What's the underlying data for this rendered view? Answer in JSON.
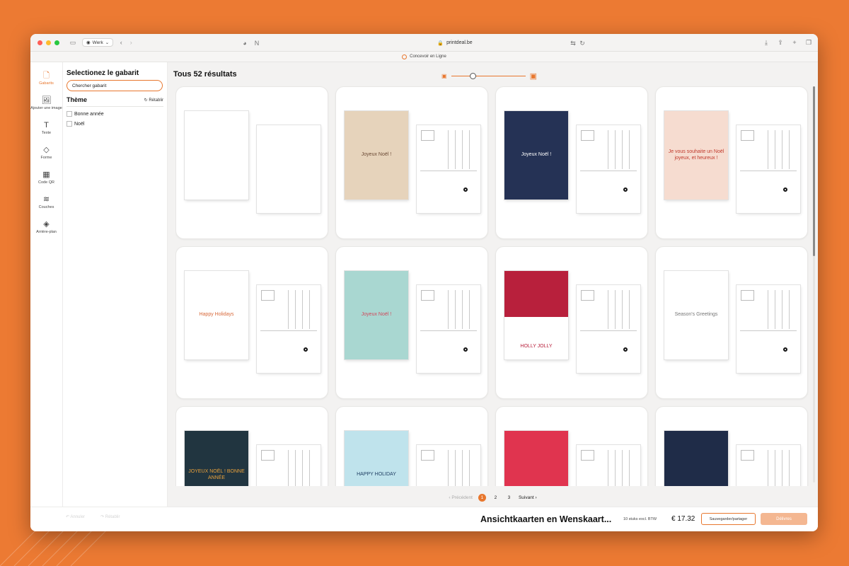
{
  "browser": {
    "profile_label": "Werk",
    "url": "printdeal.be",
    "page_title": "Concevoir en Ligne",
    "traffic_light_colors": [
      "#ff5f57",
      "#febc2e",
      "#28c840"
    ]
  },
  "rail": {
    "items": [
      {
        "label": "Gabarits",
        "icon": "template-icon"
      },
      {
        "label": "Ajouter une image",
        "icon": "image-icon"
      },
      {
        "label": "Texte",
        "icon": "text-icon"
      },
      {
        "label": "Forme",
        "icon": "shape-icon"
      },
      {
        "label": "Code QR",
        "icon": "qr-code-icon"
      },
      {
        "label": "Couches",
        "icon": "layers-icon"
      },
      {
        "label": "Arrière-plan",
        "icon": "paint-bucket-icon"
      }
    ]
  },
  "panel": {
    "title": "Selectionez le gabarit",
    "search_placeholder": "Chercher gabarit",
    "theme_title": "Thème",
    "reset_label": "Rétablir",
    "filters": [
      "Bonne année",
      "Noël"
    ]
  },
  "main": {
    "results_title": "Tous 52 résultats",
    "zoom_level": 0.25,
    "cards": [
      {
        "front_bg": "#ffffff",
        "front_text": "",
        "front_color": "#333333"
      },
      {
        "front_bg": "#e6d3bb",
        "front_text": "Joyeux Noël !",
        "front_color": "#6b4a35"
      },
      {
        "front_bg": "#253255",
        "front_text": "Joyeux Noël !",
        "front_color": "#ffffff"
      },
      {
        "front_bg": "#f6dcd0",
        "front_text": "Je vous souhaite un Noël joyeux, et heureux !",
        "front_color": "#c0392b"
      },
      {
        "front_bg": "#ffffff",
        "front_text": "Happy Holidays",
        "front_color": "#d8693a"
      },
      {
        "front_bg": "#a9d7d1",
        "front_text": "Joyeux Noël !",
        "front_color": "#d04a5c"
      },
      {
        "front_bg": "#b8203c",
        "front_text": "HOLLY JOLLY",
        "front_color": "#b8203c"
      },
      {
        "front_bg": "#ffffff",
        "front_text": "Season's Greetings",
        "front_color": "#777777"
      },
      {
        "front_bg": "#213540",
        "front_text": "JOYEUX NOËL ! BONNE ANNÉE",
        "front_color": "#e9a13b"
      },
      {
        "front_bg": "#bfe3ec",
        "front_text": "HAPPY HOLIDAY",
        "front_color": "#1f3e63"
      },
      {
        "front_bg": "#e0344f",
        "front_text": "",
        "front_color": "#ffffff"
      },
      {
        "front_bg": "#1f2c48",
        "front_text": "",
        "front_color": "#e9c46a"
      }
    ]
  },
  "pager": {
    "prev_label": "Précédent",
    "pages": [
      "1",
      "2",
      "3"
    ],
    "current": "1",
    "next_label": "Suivant"
  },
  "footer": {
    "undo_label": "Annuler",
    "redo_label": "Rétablir",
    "product_name": "Ansichtkaarten en Wenskaart...",
    "quantity": "10 stuks excl. BTW",
    "price": "€ 17.32",
    "save_label": "Sauvegarder/partager",
    "deliver_label": "Délivres"
  },
  "colors": {
    "accent": "#e8772e",
    "background": "#ec7a33"
  }
}
